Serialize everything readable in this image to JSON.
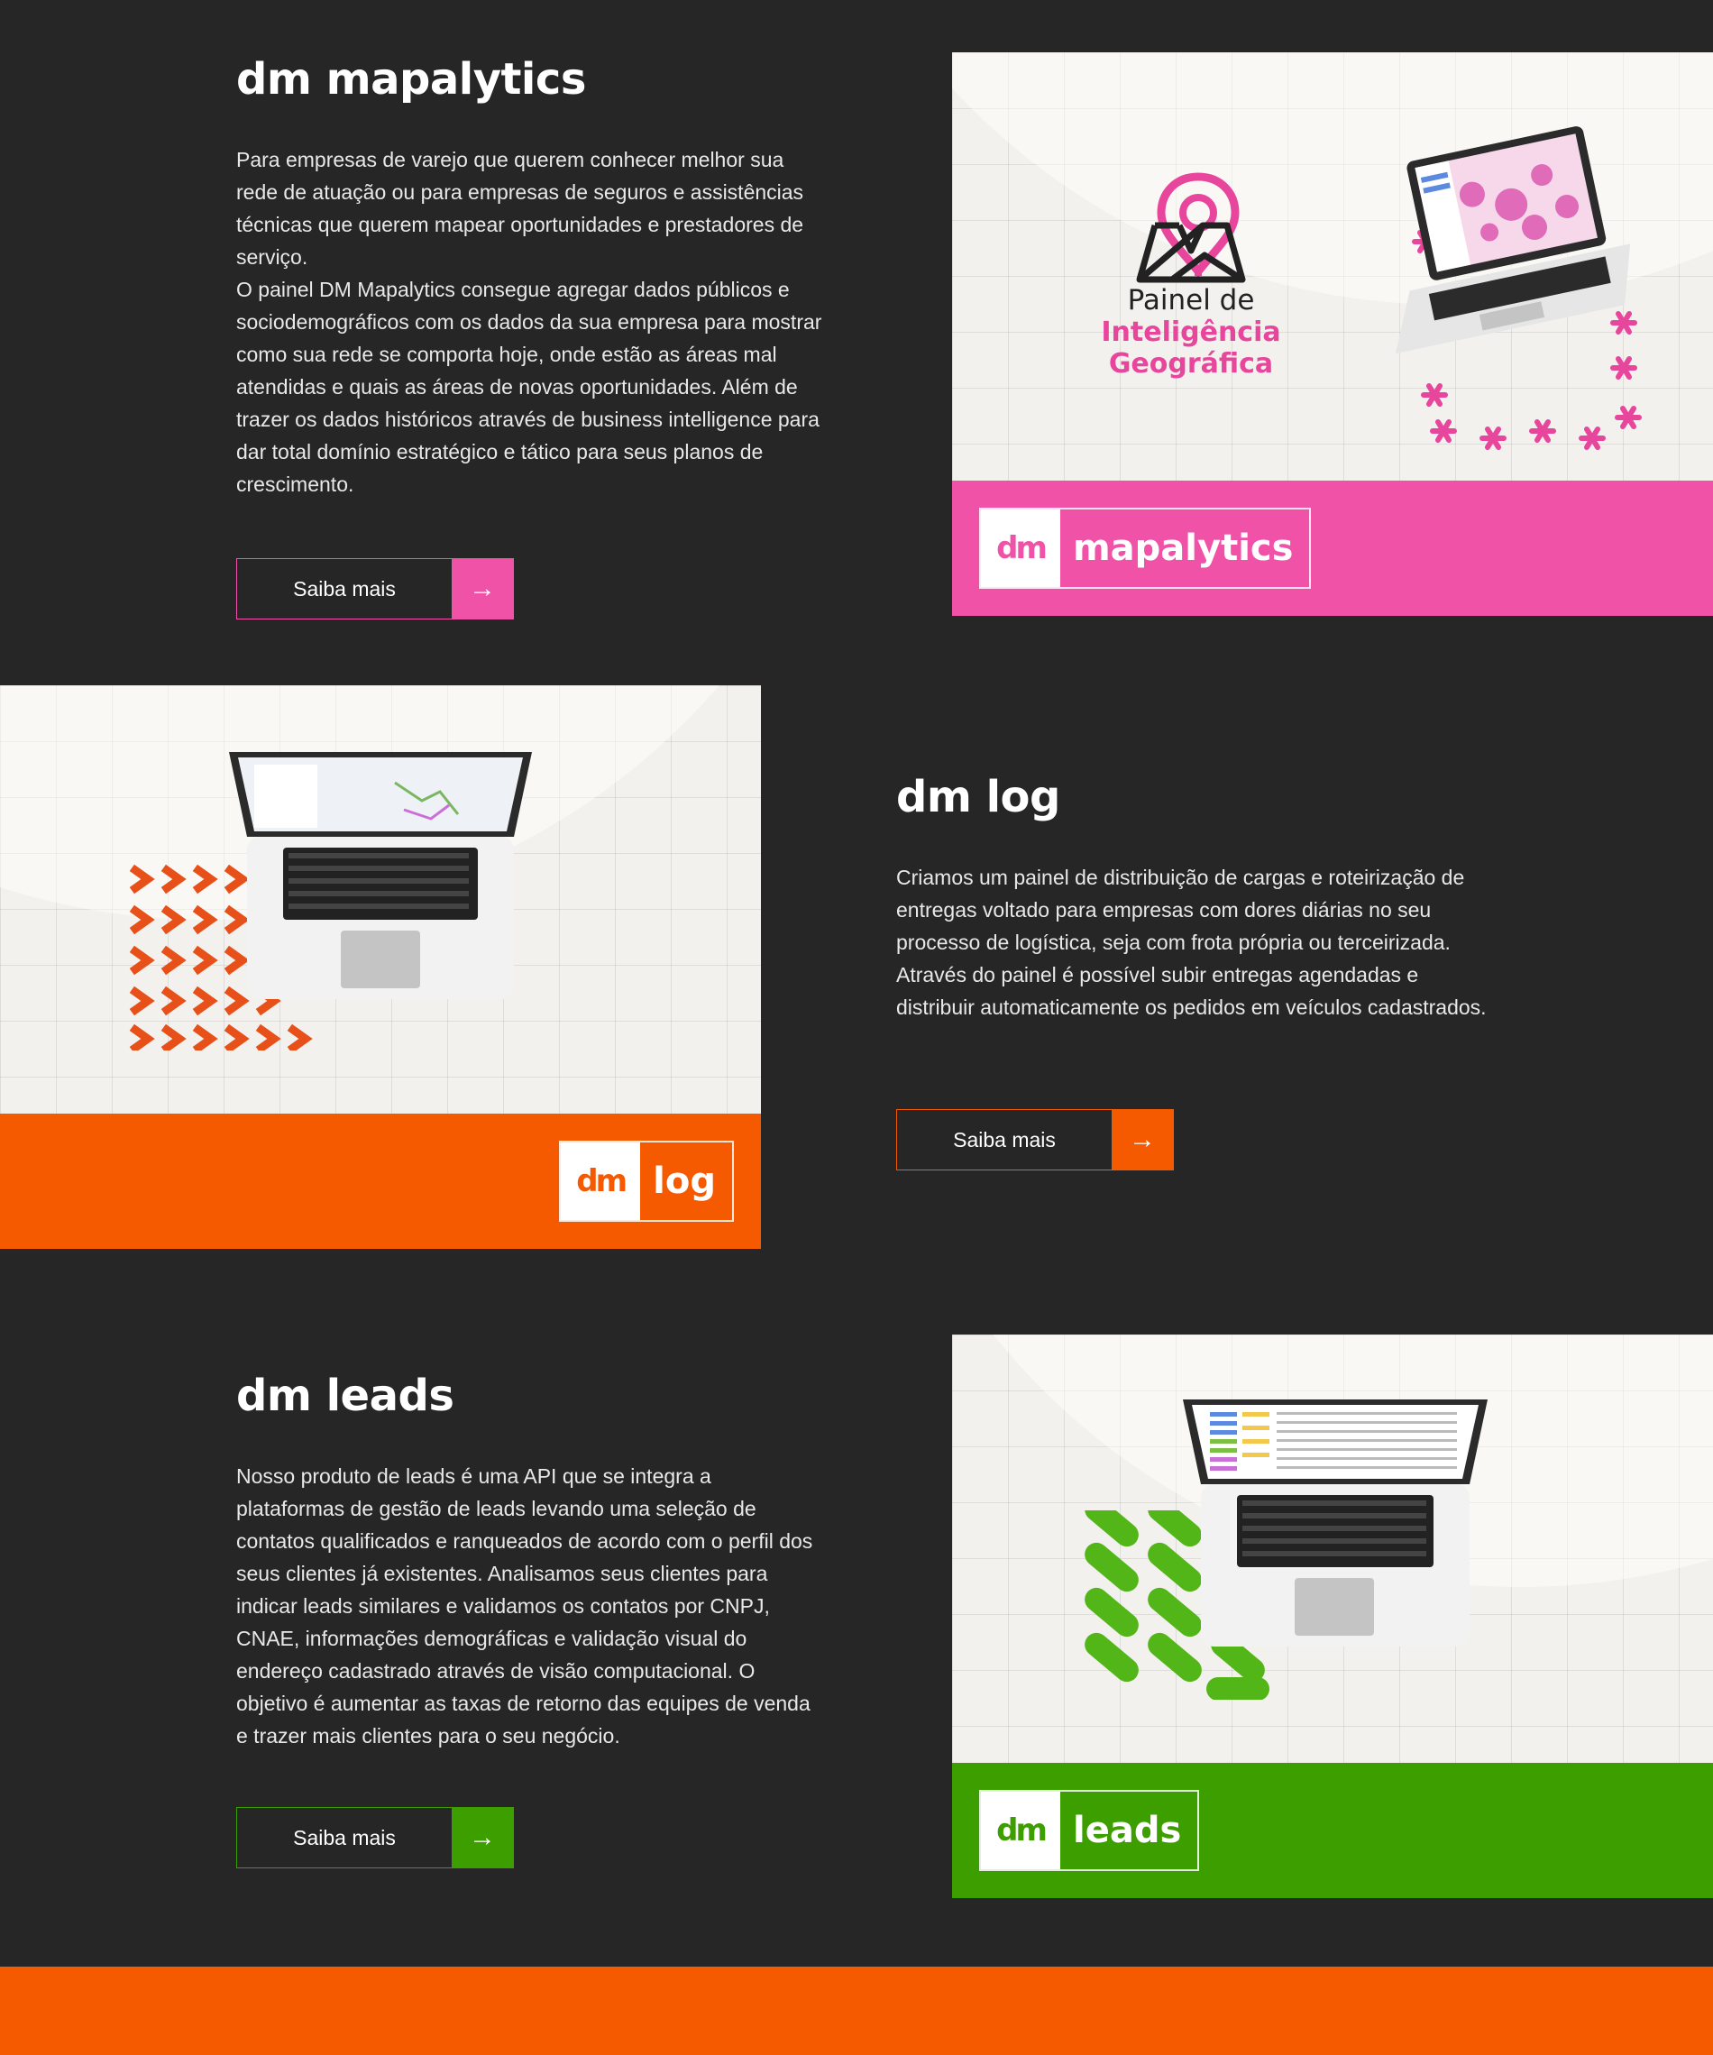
{
  "colors": {
    "background": "#262626",
    "pink": "#f052a7",
    "orange": "#f55a00",
    "green": "#3d9e00",
    "cream": "#f3f1ed"
  },
  "mapalytics": {
    "title": "dm mapalytics",
    "paragraph1": "Para empresas de varejo que querem conhecer melhor sua rede de atuação ou para empresas de seguros e assistências técnicas que querem mapear oportunidades e prestadores de serviço.",
    "paragraph2": "O painel DM Mapalytics consegue agregar dados públicos e sociodemográficos com os dados da sua empresa para mostrar como sua rede se comporta hoje, onde estão as áreas mal atendidas e quais as áreas de novas oportunidades. Além de trazer os dados históricos através de business intelligence para dar total domínio estratégico e tático para seus planos de crescimento.",
    "button_label": "Saiba mais",
    "button_arrow": "→",
    "art_line1": "Painel de",
    "art_line2": "Inteligência",
    "art_line3": "Geográfica",
    "logo_dm": "dm",
    "logo_name": "mapalytics",
    "icons": [
      "map-pin-icon",
      "folded-map-icon",
      "laptop-icon"
    ]
  },
  "log": {
    "title": "dm log",
    "paragraph1": "Criamos um painel de distribuição de cargas e roteirização de entregas voltado para empresas com dores diárias no seu processo de logística, seja com frota própria ou terceirizada. Através do painel é possível subir entregas agendadas e distribuir automaticamente os pedidos em veículos cadastrados.",
    "button_label": "Saiba mais",
    "button_arrow": "→",
    "logo_dm": "dm",
    "logo_name": "log"
  },
  "leads": {
    "title": "dm leads",
    "paragraph1": "Nosso produto de leads é uma API que se integra a plataformas de gestão de leads levando uma seleção de contatos qualificados e ranqueados de acordo com o perfil dos seus clientes já existentes. Analisamos seus clientes para indicar leads similares e validamos os contatos por CNPJ, CNAE, informações demográficas e validação visual do endereço cadastrado através de visão computacional. O objetivo é aumentar as taxas de retorno das equipes de venda e trazer mais clientes para o seu negócio.",
    "button_label": "Saiba mais",
    "button_arrow": "→",
    "logo_dm": "dm",
    "logo_name": "leads"
  }
}
